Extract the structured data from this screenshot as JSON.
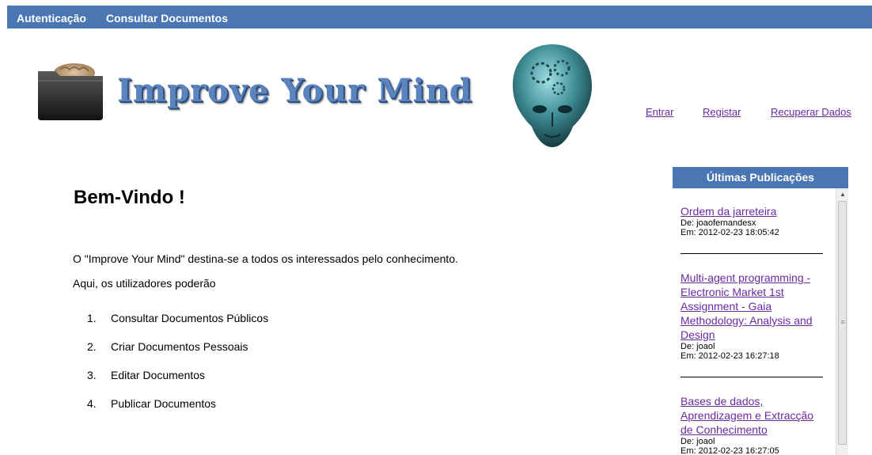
{
  "nav": {
    "auth": "Autenticação",
    "docs": "Consultar Documentos"
  },
  "logo": {
    "title": "Improve Your Mind"
  },
  "auth_links": {
    "enter": "Entrar",
    "register": "Registar",
    "recover": "Recuperar Dados"
  },
  "main": {
    "heading": "Bem-Vindo !",
    "intro": "O \"Improve Your Mind\" destina-se a todos os interessados pelo conhecimento.",
    "intro2": "Aqui, os utilizadores poderão",
    "features": [
      {
        "num": "1.",
        "label": "Consultar Documentos Públicos"
      },
      {
        "num": "2.",
        "label": "Criar Documentos Pessoais"
      },
      {
        "num": "3.",
        "label": "Editar Documentos"
      },
      {
        "num": "4.",
        "label": "Publicar Documentos"
      }
    ]
  },
  "publications": {
    "title": "Últimas Publicações",
    "items": [
      {
        "title": "Ordem da jarreteira",
        "author": "De: joaofernandesx",
        "date": "Em: 2012-02-23 18:05:42"
      },
      {
        "title": "Multi-agent programming - Electronic Market 1st Assignment - Gaia Methodology: Analysis and Design",
        "author": "De: joaol",
        "date": "Em: 2012-02-23 16:27:18"
      },
      {
        "title": "Bases de dados, Aprendizagem e Extracção de Conhecimento",
        "author": "De: joaol",
        "date": "Em: 2012-02-23 16:27:05"
      }
    ]
  },
  "colors": {
    "nav_bg": "#4a77b4",
    "link": "#6a2aa0",
    "logo_text": "#5b83bd"
  }
}
